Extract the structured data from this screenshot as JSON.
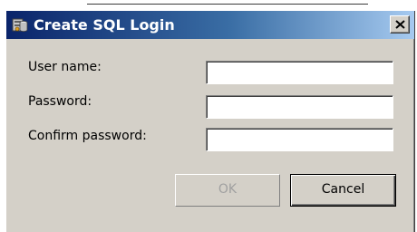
{
  "dialog": {
    "title": "Create SQL Login",
    "icon": "sql-server-icon",
    "close_icon": "close-icon"
  },
  "form": {
    "user_name_label": "User name:",
    "user_name_value": "",
    "password_label": "Password:",
    "password_value": "",
    "confirm_password_label": "Confirm password:",
    "confirm_password_value": ""
  },
  "buttons": {
    "ok_label": "OK",
    "ok_enabled": false,
    "cancel_label": "Cancel"
  }
}
